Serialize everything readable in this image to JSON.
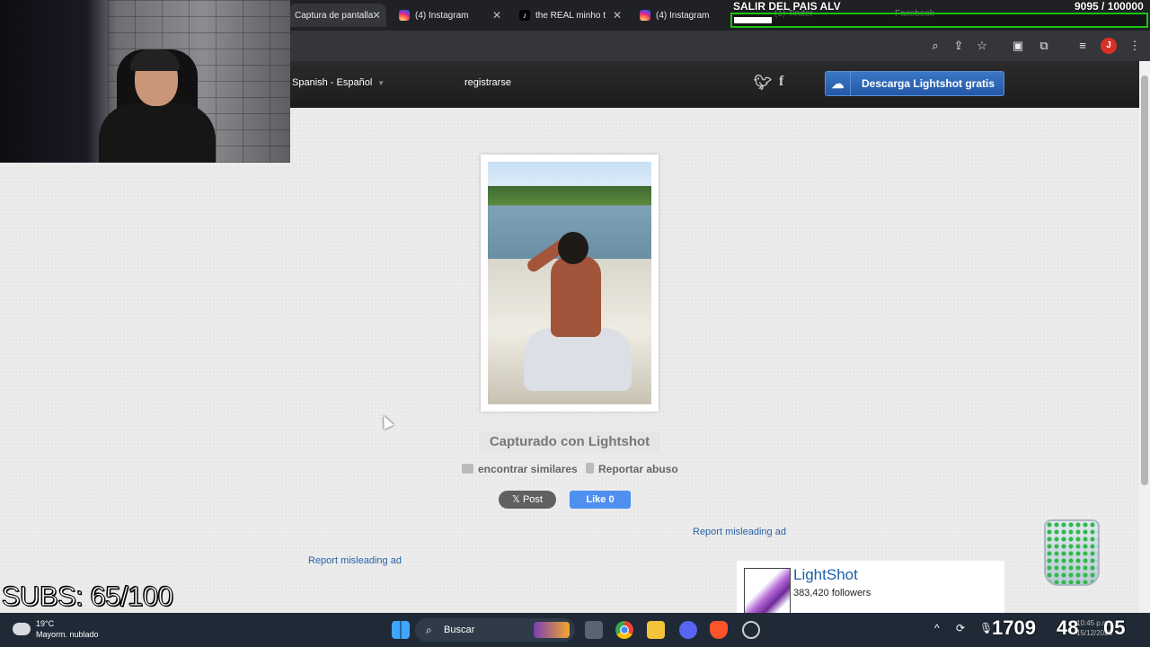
{
  "browser": {
    "tabs": [
      {
        "label": "Captura de pantalla",
        "icon": "lightshot-icon",
        "active": true
      },
      {
        "label": "(4) Instagram",
        "icon": "instagram-icon",
        "active": false
      },
      {
        "label": "the REAL minho tr",
        "icon": "tiktok-icon",
        "active": false
      },
      {
        "label": "(4) Instagram",
        "icon": "instagram-icon",
        "active": false
      },
      {
        "label": "(1) Tinder",
        "icon": "tinder-icon",
        "active": false
      },
      {
        "label": "Facebook",
        "icon": "facebook-icon",
        "active": false
      }
    ],
    "toolbar_icons": [
      "zoom-icon",
      "install-app-icon",
      "bookmark-star-icon",
      "screen-capture-icon",
      "extensions-icon",
      "media-control-icon"
    ],
    "profile_initial": "J"
  },
  "lightshot": {
    "language": "Spanish - Español",
    "register": "registrarse",
    "download_button": "Descarga Lightshot gratis",
    "captured_with": "Capturado con Lightshot",
    "find_similar": "encontrar similares",
    "report_abuse": "Reportar abuso",
    "x_post": "𝕏 Post",
    "fb_like": "Like 0",
    "report_ad_right": "Report misleading ad",
    "report_ad_left": "Report misleading ad",
    "fb_page_name": "LightShot",
    "fb_followers": "383,420 followers"
  },
  "stream": {
    "goal_title": "SALIR DEL PAIS ALV",
    "goal_count": "9095 / 100000",
    "goal_progress": 0.09095,
    "subs": "SUBS: 65/100",
    "goal_color": "#19c40e"
  },
  "taskbar": {
    "weather_temp": "19°C",
    "weather_desc": "Mayorm. nublado",
    "search_label": "Buscar",
    "clock_hours": "1709",
    "clock_minutes": "48",
    "clock_seconds": "05",
    "small_time": "10:45 p.m.",
    "small_date": "15/12/2023"
  }
}
